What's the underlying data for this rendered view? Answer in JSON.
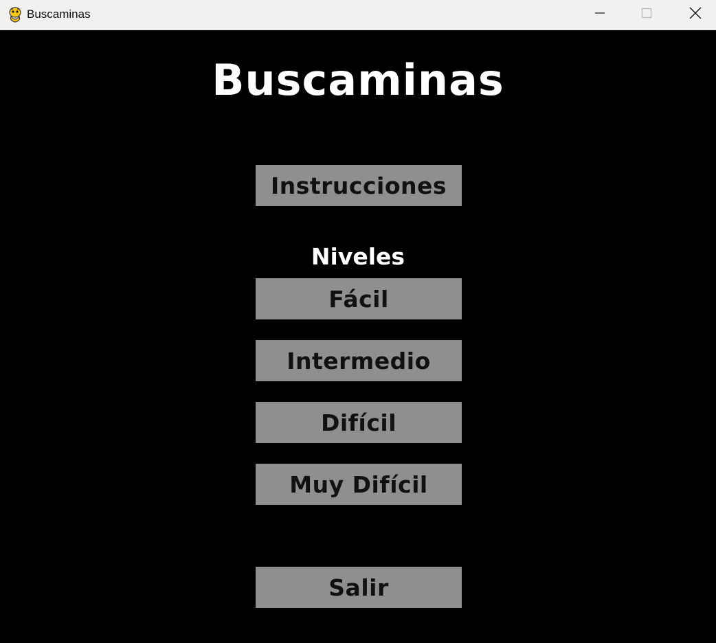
{
  "window": {
    "title": "Buscaminas",
    "icon": "pygame-snake-icon",
    "controls": [
      "minimize-icon",
      "maximize-icon",
      "close-icon"
    ]
  },
  "main": {
    "title": "Buscaminas",
    "instructions_label": "Instrucciones",
    "levels_heading": "Niveles",
    "levels": [
      "Fácil",
      "Intermedio",
      "Difícil",
      "Muy Difícil"
    ],
    "exit_label": "Salir"
  },
  "colors": {
    "background": "#000000",
    "button": "#8f8f8f",
    "button_text": "#111111",
    "title_text": "#ffffff",
    "titlebar": "#f3f0f0"
  }
}
